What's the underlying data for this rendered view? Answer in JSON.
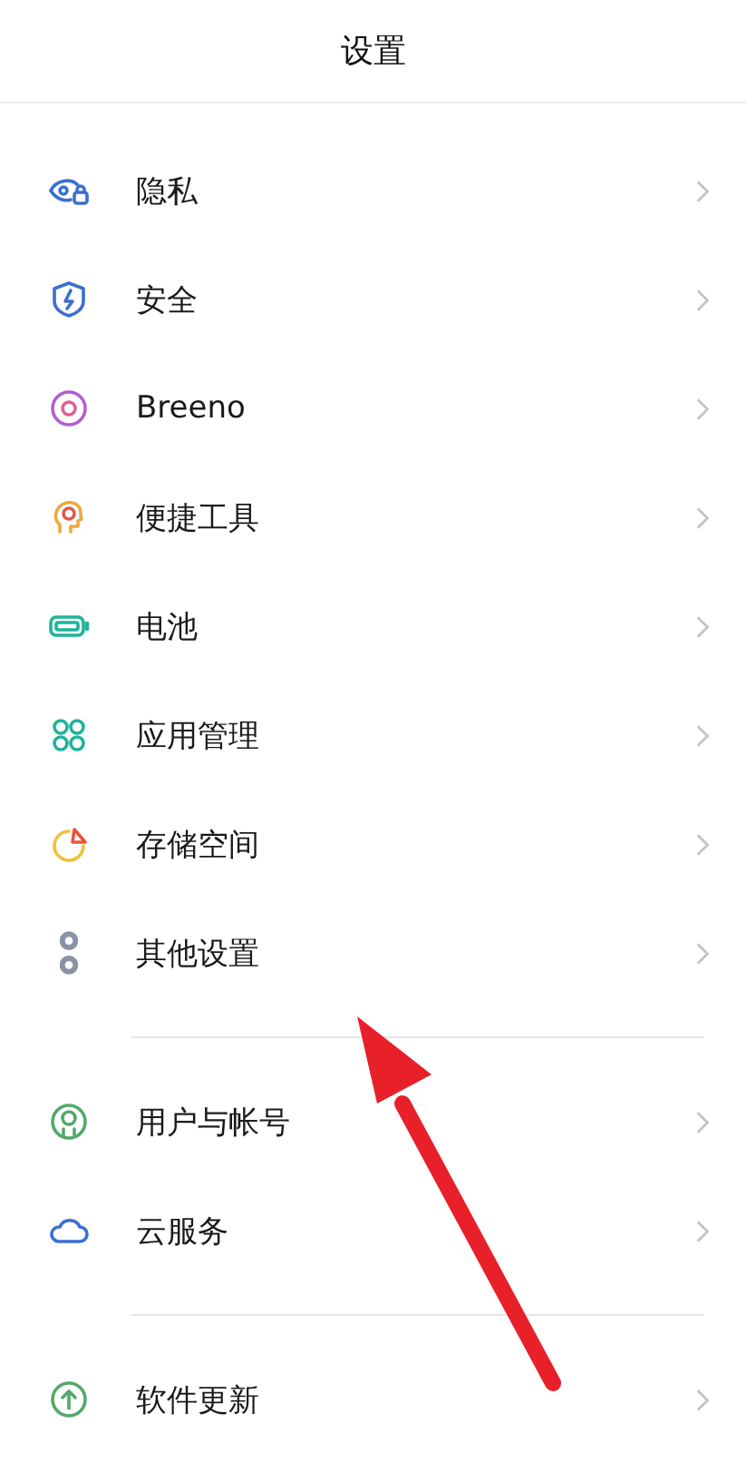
{
  "header": {
    "title": "设置"
  },
  "groups": [
    {
      "items": [
        {
          "label": "隐私",
          "kind": "privacy"
        },
        {
          "label": "安全",
          "kind": "security"
        },
        {
          "label": "Breeno",
          "kind": "breeno"
        },
        {
          "label": "便捷工具",
          "kind": "shortcut"
        },
        {
          "label": "电池",
          "kind": "battery"
        },
        {
          "label": "应用管理",
          "kind": "apps"
        },
        {
          "label": "存储空间",
          "kind": "storage"
        },
        {
          "label": "其他设置",
          "kind": "other"
        }
      ]
    },
    {
      "items": [
        {
          "label": "用户与帐号",
          "kind": "account"
        },
        {
          "label": "云服务",
          "kind": "cloud"
        }
      ]
    },
    {
      "items": [
        {
          "label": "软件更新",
          "kind": "update"
        }
      ]
    }
  ]
}
